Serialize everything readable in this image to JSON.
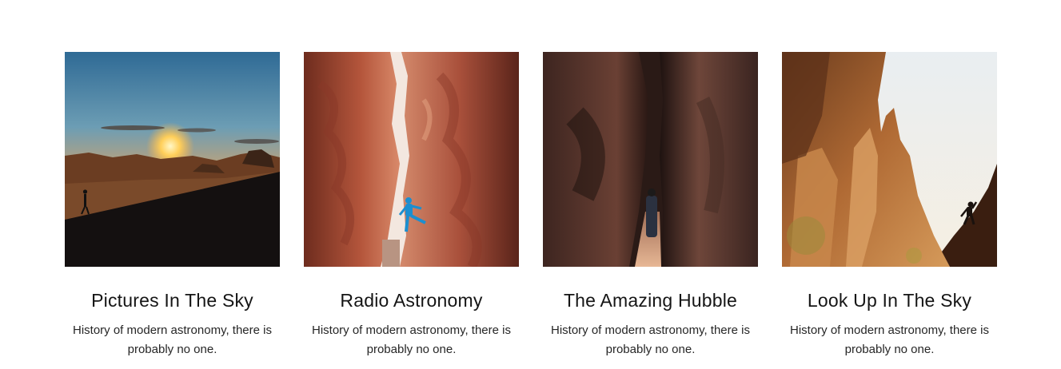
{
  "cards": [
    {
      "title": "Pictures In The Sky",
      "description": "History of modern astronomy, there is probably no one.",
      "image_alt": "Hiker on a desert dune at sunset"
    },
    {
      "title": "Radio Astronomy",
      "description": "History of modern astronomy, there is probably no one.",
      "image_alt": "Climber in blue between red canyon walls"
    },
    {
      "title": "The Amazing Hubble",
      "description": "History of modern astronomy, there is probably no one.",
      "image_alt": "Person standing in a dark narrow canyon"
    },
    {
      "title": "Look Up In The Sky",
      "description": "History of modern astronomy, there is probably no one.",
      "image_alt": "Climber on sunlit desert rock towers"
    }
  ]
}
